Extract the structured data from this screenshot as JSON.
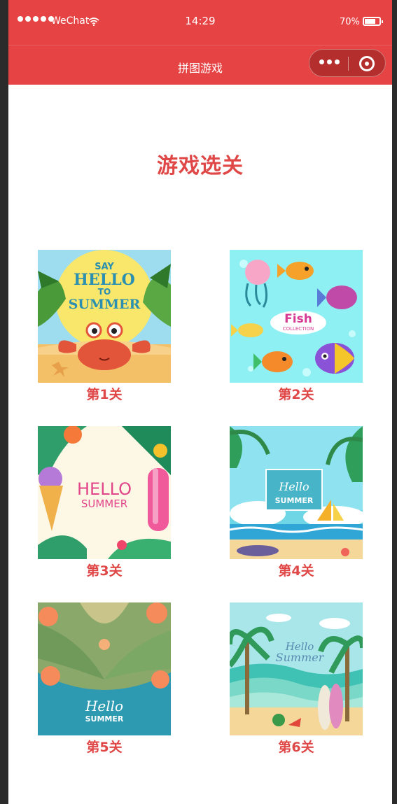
{
  "status_bar": {
    "carrier": "WeChat",
    "time": "14:29",
    "battery": "70%",
    "battery_level": 0.7
  },
  "nav": {
    "title": "拼图游戏"
  },
  "page": {
    "title": "游戏选关"
  },
  "levels": [
    {
      "label": "第1关",
      "image_text": [
        "SAY",
        "HELLO",
        "TO",
        "SUMMER"
      ]
    },
    {
      "label": "第2关",
      "image_text": [
        "Fish",
        "COLLECTION"
      ]
    },
    {
      "label": "第3关",
      "image_text": [
        "HELLO",
        "SUMMER"
      ]
    },
    {
      "label": "第4关",
      "image_text": [
        "Hello",
        "SUMMER"
      ]
    },
    {
      "label": "第5关",
      "image_text": [
        "Hello",
        "SUMMER"
      ]
    },
    {
      "label": "第6关",
      "image_text": [
        "Hello",
        "Summer"
      ]
    }
  ],
  "colors": {
    "header_red": "#e64444",
    "title_red": "#e04848",
    "background": "#ffffff"
  }
}
